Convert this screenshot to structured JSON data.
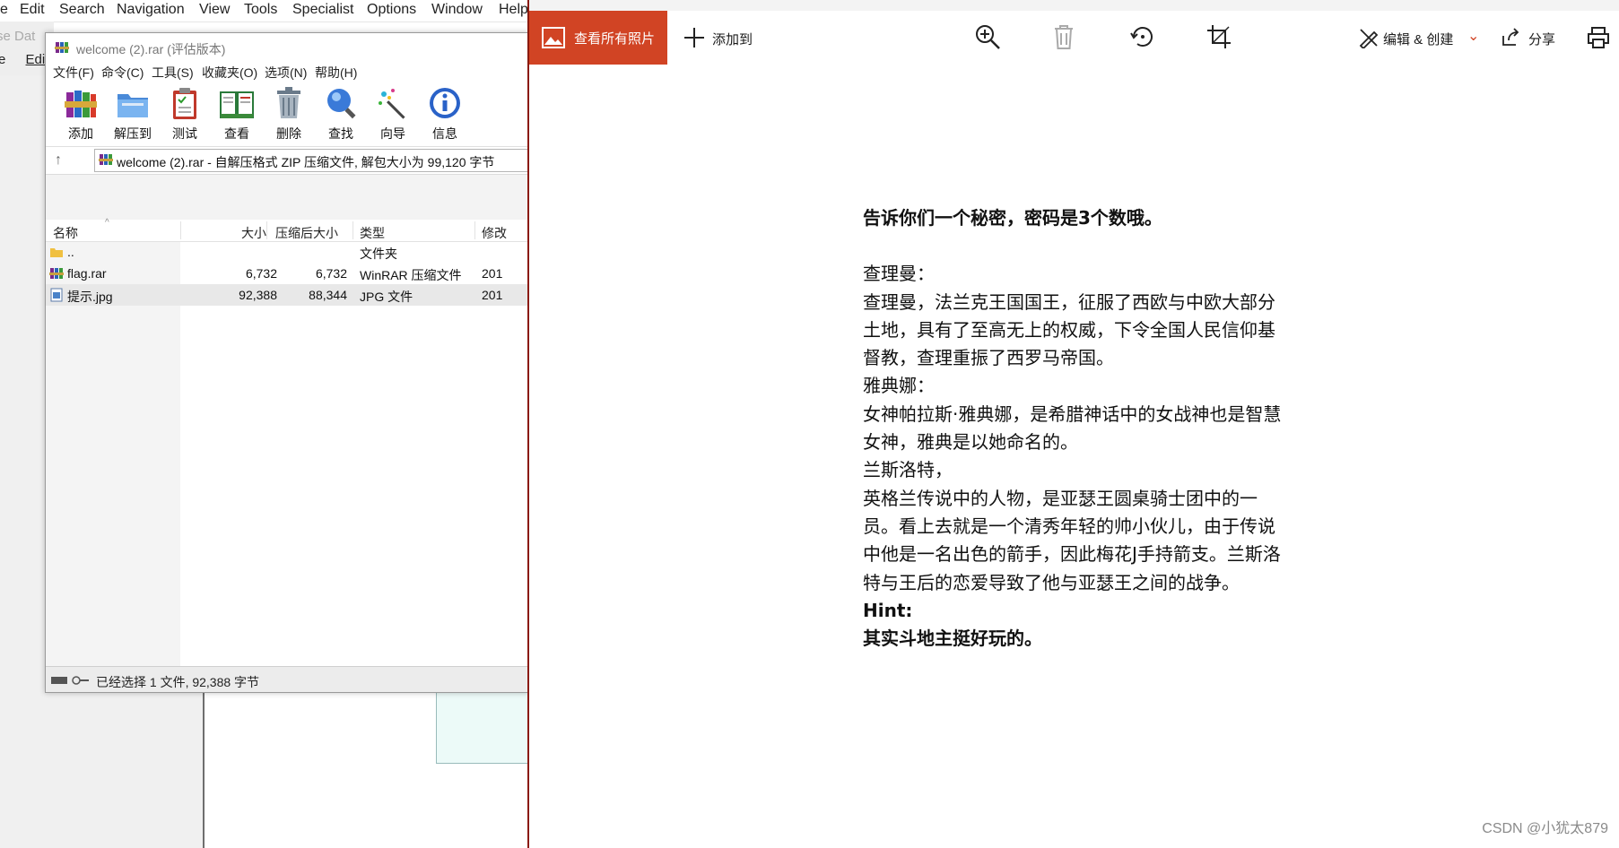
{
  "background_app": {
    "menu": [
      "e",
      "Edit",
      "Search",
      "Navigation",
      "View",
      "Tools",
      "Specialist",
      "Options",
      "Window",
      "Help"
    ],
    "row2_text": "se Dat",
    "row2_text2": "e",
    "row2_text3": "Edi"
  },
  "winrar": {
    "title": "welcome (2).rar (评估版本)",
    "menu": [
      "文件(F)",
      "命令(C)",
      "工具(S)",
      "收藏夹(O)",
      "选项(N)",
      "帮助(H)"
    ],
    "toolbar": [
      {
        "label": "添加",
        "icon": "add-books-icon"
      },
      {
        "label": "解压到",
        "icon": "extract-folder-icon"
      },
      {
        "label": "测试",
        "icon": "test-clipboard-icon"
      },
      {
        "label": "查看",
        "icon": "view-book-icon"
      },
      {
        "label": "删除",
        "icon": "delete-trash-icon"
      },
      {
        "label": "查找",
        "icon": "find-magnifier-icon"
      },
      {
        "label": "向导",
        "icon": "wizard-wand-icon"
      },
      {
        "label": "信息",
        "icon": "info-icon"
      }
    ],
    "address": "welcome (2).rar - 自解压格式 ZIP 压缩文件, 解包大小为 99,120 字节",
    "columns": {
      "name": "名称",
      "size": "大小",
      "packed": "压缩后大小",
      "type": "类型",
      "modified": "修改"
    },
    "rows": [
      {
        "name": "..",
        "size": "",
        "packed": "",
        "type": "文件夹",
        "modified": ""
      },
      {
        "name": "flag.rar",
        "size": "6,732",
        "packed": "6,732",
        "type": "WinRAR 压缩文件",
        "modified": "201"
      },
      {
        "name": "提示.jpg",
        "size": "92,388",
        "packed": "88,344",
        "type": "JPG 文件",
        "modified": "201"
      }
    ],
    "status": "已经选择 1 文件, 92,388 字节"
  },
  "photos": {
    "view_all": "查看所有照片",
    "add_to": "添加到",
    "edit_create": "编辑 & 创建",
    "share": "分享",
    "accent": "#d14424",
    "content": {
      "headline": "告诉你们一个秘密，密码是3个数哦。",
      "lines": [
        "查理曼：",
        "查理曼，法兰克王国国王，征服了西欧与中欧大部分",
        "土地，具有了至高无上的权威，下令全国人民信仰基",
        "督教，查理重振了西罗马帝国。",
        "雅典娜：",
        "女神帕拉斯·雅典娜，是希腊神话中的女战神也是智慧",
        "女神，雅典是以她命名的。",
        "兰斯洛特，",
        "英格兰传说中的人物，是亚瑟王圆桌骑士团中的一",
        "员。看上去就是一个清秀年轻的帅小伙儿，由于传说",
        "中他是一名出色的箭手，因此梅花J手持箭支。兰斯洛",
        "特与王后的恋爱导致了他与亚瑟王之间的战争。"
      ],
      "hint_label": "Hint:",
      "hint_text": "其实斗地主挺好玩的。"
    }
  },
  "watermark": "CSDN @小犹太879"
}
